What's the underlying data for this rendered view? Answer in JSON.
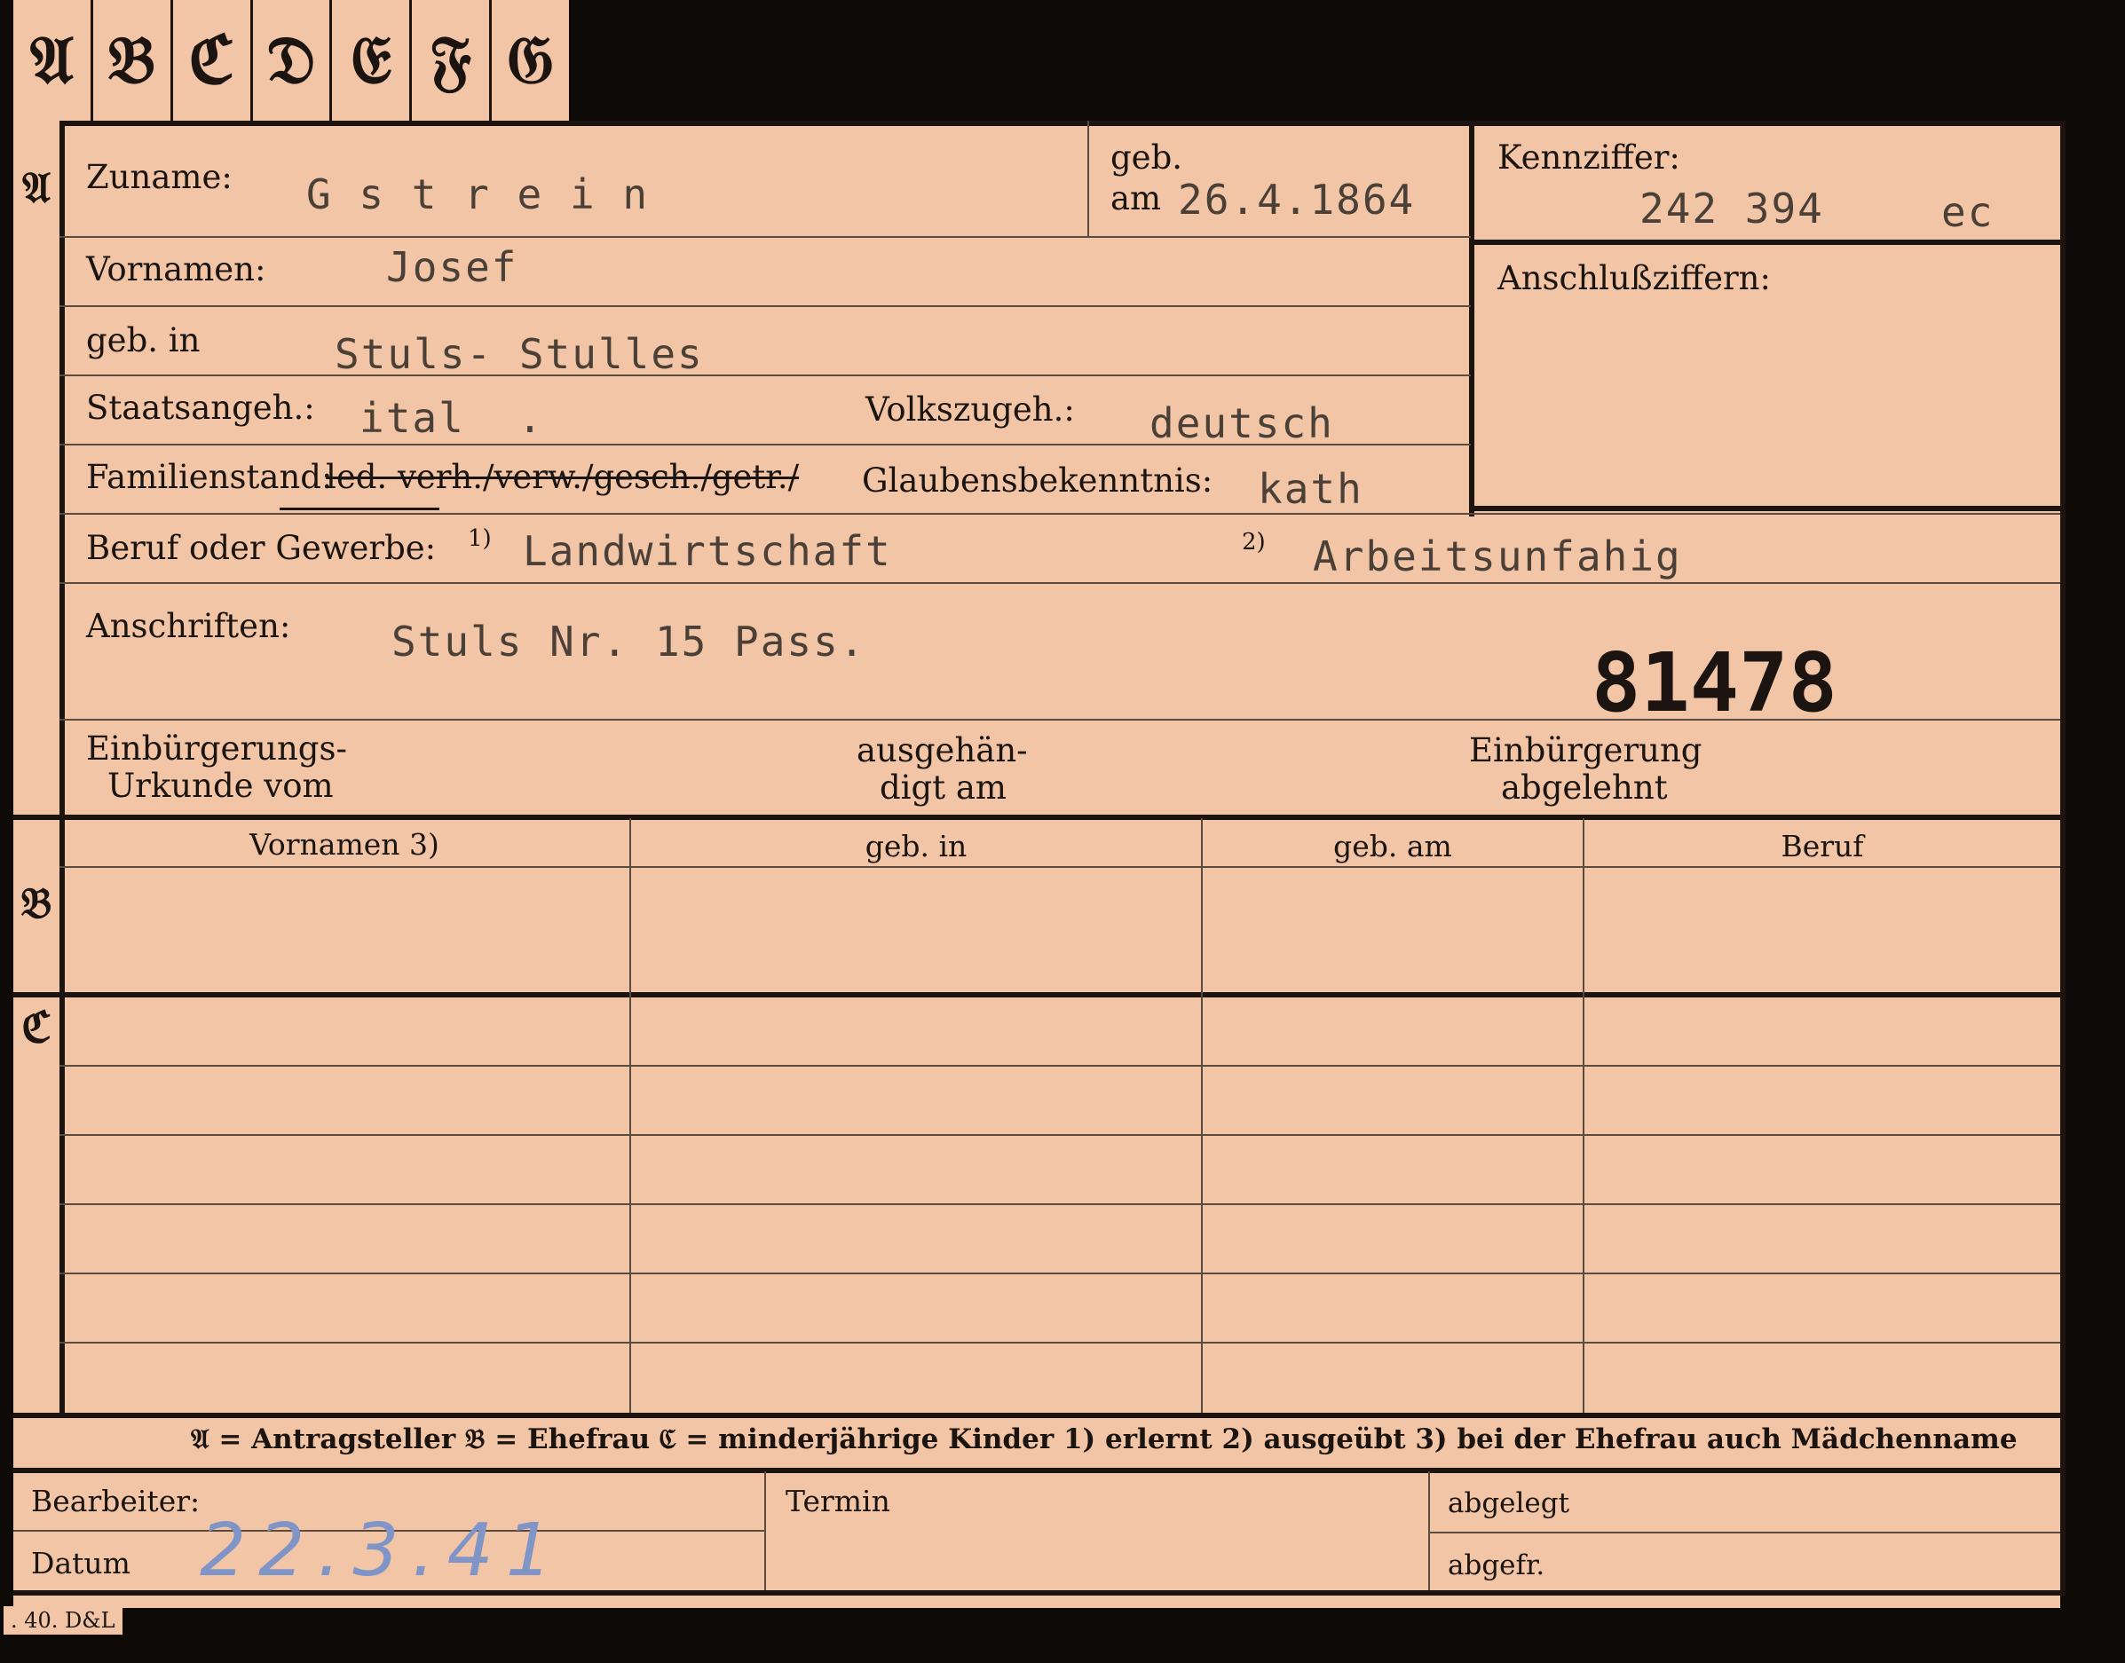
{
  "tabs": [
    "𝔄",
    "𝔅",
    "ℭ",
    "𝔇",
    "𝔈",
    "𝔉",
    "𝔊"
  ],
  "section_markers": {
    "a": "𝔄",
    "b": "𝔅",
    "c": "ℭ"
  },
  "section_a": {
    "zuname_label": "Zuname:",
    "zuname_value": "G s t r e i n",
    "geb_label": "geb.",
    "am_label": "am",
    "geb_date": "26.4.1864",
    "kennziffer_label": "Kennziffer:",
    "kennziffer_value": "242 394",
    "kennziffer_suffix": "ec",
    "anschlussziffern_label": "Anschlußziffern:",
    "vornamen_label": "Vornamen:",
    "vornamen_value": "Josef",
    "geb_in_label": "geb. in",
    "geb_in_value": "Stuls- Stulles",
    "staatsangeh_label": "Staatsangeh.:",
    "staatsangeh_value": "ital  .",
    "volkszugeh_label": "Volkszugeh.:",
    "volkszugeh_value": "deutsch",
    "familienstand_label": "Familienstand:",
    "familienstand_options": "led. verh./verw./gesch./getr./",
    "glaubens_label": "Glaubensbekenntnis:",
    "glaubens_value": "kath",
    "beruf_label": "Beruf oder Gewerbe:",
    "beruf_note1": "1)",
    "beruf_value1": "Landwirtschaft",
    "beruf_note2": "2)",
    "beruf_value2": "Arbeitsunfahig",
    "anschriften_label": "Anschriften:",
    "anschriften_value": "Stuls Nr. 15 Pass.",
    "stamp_number": "81478",
    "einbuergerung_urkunde_label_1": "Einbürgerungs-",
    "einbuergerung_urkunde_label_2": "Urkunde vom",
    "ausgehaendigt_label_1": "ausgehän-",
    "ausgehaendigt_label_2": "digt am",
    "einbuergerung_abgelehnt_label_1": "Einbürgerung",
    "einbuergerung_abgelehnt_label_2": "abgelehnt"
  },
  "table": {
    "headers": [
      "Vornamen 3)",
      "geb. in",
      "geb. am",
      "Beruf"
    ]
  },
  "legend": "𝔄 = Antragsteller   𝔅 = Ehefrau   ℭ = minderjährige Kinder   1) erlernt   2) ausgeübt   3) bei der Ehefrau auch Mädchenname",
  "footer": {
    "bearbeiter_label": "Bearbeiter:",
    "datum_label": "Datum",
    "datum_value": "22.3.41",
    "termin_label": "Termin",
    "abgelegt_label": "abgelegt",
    "abgefr_label": "abgefr."
  },
  "print_mark": ". 40. D&L"
}
